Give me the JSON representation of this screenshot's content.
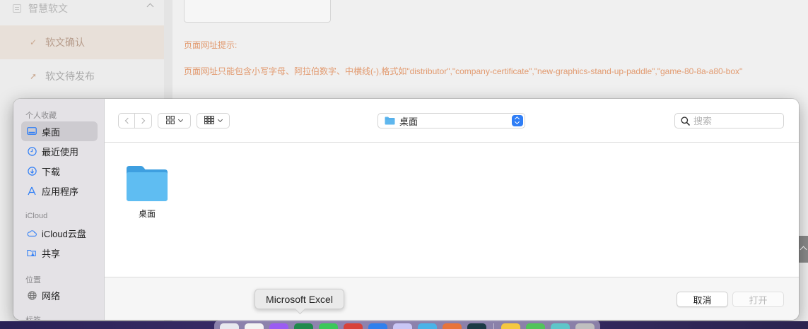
{
  "background_page": {
    "menu_group": {
      "label": "智慧软文"
    },
    "menu_items": [
      {
        "label": "软文确认",
        "icon": "check-icon",
        "active": true
      },
      {
        "label": "软文待发布",
        "icon": "send-icon",
        "active": false
      }
    ],
    "hint_title": "页面网址提示:",
    "hint_text": "页面网址只能包含小写字母、阿拉伯数字、中横线(-),格式如\"distributor\",\"company-certificate\",\"new-graphics-stand-up-paddle\",\"game-80-8a-a80-box\"",
    "accent_color": "#e29a6f"
  },
  "dialog": {
    "sidebar": {
      "favorites_header": "个人收藏",
      "favorites": [
        {
          "label": "桌面",
          "icon": "desktop-icon",
          "selected": true
        },
        {
          "label": "最近使用",
          "icon": "clock-icon",
          "selected": false
        },
        {
          "label": "下载",
          "icon": "download-icon",
          "selected": false
        },
        {
          "label": "应用程序",
          "icon": "applications-icon",
          "selected": false
        }
      ],
      "icloud_header": "iCloud",
      "icloud": [
        {
          "label": "iCloud云盘",
          "icon": "cloud-icon"
        },
        {
          "label": "共享",
          "icon": "shared-folder-icon"
        }
      ],
      "locations_header": "位置",
      "locations": [
        {
          "label": "网络",
          "icon": "globe-icon"
        }
      ],
      "tags_header": "标签"
    },
    "toolbar": {
      "location": "桌面",
      "search_placeholder": "搜索"
    },
    "files": [
      {
        "name": "桌面",
        "type": "folder"
      }
    ],
    "footer": {
      "cancel_label": "取消",
      "open_label": "打开"
    }
  },
  "tooltip": {
    "text": "Microsoft Excel"
  },
  "colors": {
    "folder_blue": "#5fb7ee",
    "selection": "#cdcbd0",
    "stepper_blue": "#2f7ef6"
  }
}
